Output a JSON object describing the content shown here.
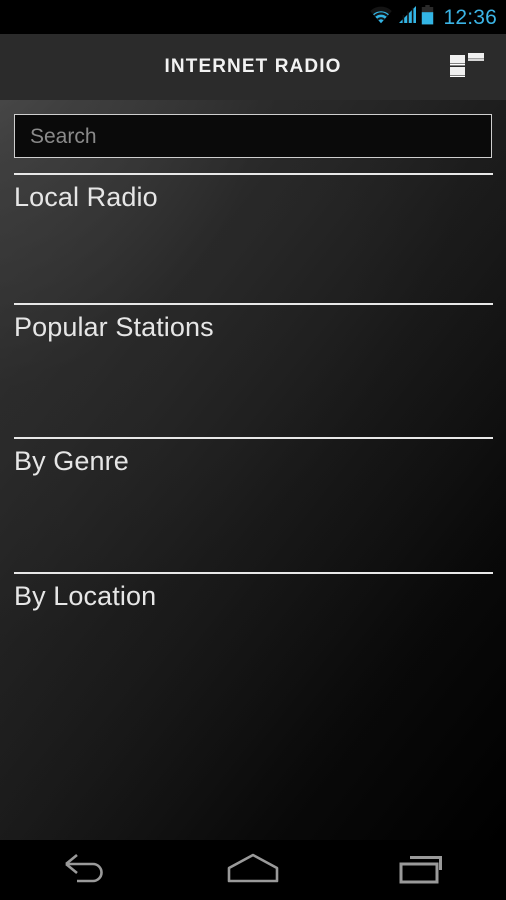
{
  "status_bar": {
    "time": "12:36",
    "icons": [
      "wifi-icon",
      "cellular-signal-icon",
      "battery-icon"
    ],
    "accent_color": "#33b5e5"
  },
  "action_bar": {
    "title": "INTERNET RADIO",
    "background_color": "#2b2b2b",
    "layout_toggle_icon": "list-layout-icon"
  },
  "search": {
    "placeholder": "Search",
    "value": ""
  },
  "list": {
    "items": [
      {
        "label": "Local Radio"
      },
      {
        "label": "Popular Stations"
      },
      {
        "label": "By Genre"
      },
      {
        "label": "By Location"
      }
    ]
  },
  "nav_bar": {
    "buttons": [
      {
        "name": "back-icon"
      },
      {
        "name": "home-icon"
      },
      {
        "name": "recents-icon"
      }
    ]
  }
}
